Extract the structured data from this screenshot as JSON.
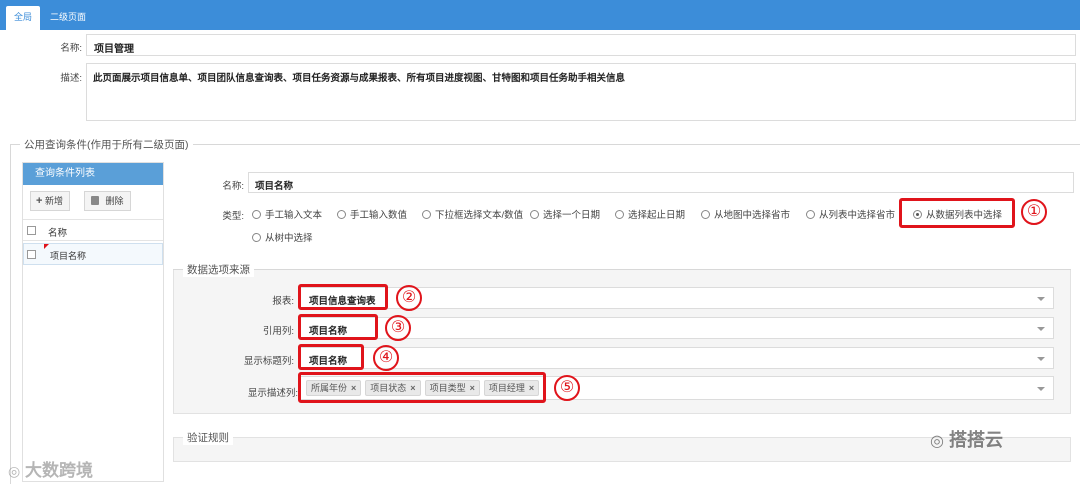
{
  "tabs": [
    {
      "label": "全局"
    },
    {
      "label": "二级页面"
    }
  ],
  "form": {
    "name_label": "名称:",
    "name_value": "项目管理",
    "desc_label": "描述:",
    "desc_value": "此页面展示项目信息单、项目团队信息查询表、项目任务资源与成果报表、所有项目进度视图、甘特图和项目任务助手相关信息"
  },
  "public_query": {
    "legend": "公用查询条件(作用于所有二级页面)",
    "list_title": "查询条件列表",
    "add_label": "新增",
    "delete_label": "删除",
    "col_header": "名称",
    "rows": [
      "项目名称"
    ]
  },
  "detail": {
    "name_label": "名称:",
    "name_value": "项目名称",
    "type_label": "类型:",
    "types": [
      "手工输入文本",
      "手工输入数值",
      "下拉框选择文本/数值",
      "选择一个日期",
      "选择起止日期",
      "从地图中选择省市",
      "从列表中选择省市",
      "从数据列表中选择",
      "从树中选择"
    ],
    "selected_type": "从数据列表中选择"
  },
  "source": {
    "legend": "数据选项来源",
    "report_label": "报表:",
    "report_value": "项目信息查询表",
    "ref_label": "引用列:",
    "ref_value": "项目名称",
    "title_col_label": "显示标题列:",
    "title_col_value": "项目名称",
    "desc_col_label": "显示描述列:",
    "desc_tags": [
      "所属年份",
      "项目状态",
      "项目类型",
      "项目经理"
    ]
  },
  "validation": {
    "legend": "验证规则"
  },
  "markers": [
    "①",
    "②",
    "③",
    "④",
    "⑤"
  ],
  "watermarks": {
    "left": "大数跨境",
    "right": "搭搭云"
  },
  "colors": {
    "accent": "#3c8dd9",
    "highlight": "#e0141b"
  }
}
